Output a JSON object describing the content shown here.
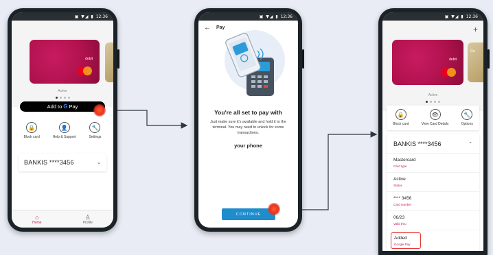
{
  "status_bar": {
    "time": "12:36",
    "icons": "▣ ▼◢ ▮"
  },
  "phone1": {
    "plus": "+",
    "card": {
      "type": "debit",
      "state": "Active"
    },
    "gpay_button": {
      "prefix": "Add to",
      "brand_g": "G",
      "brand_pay": "Pay"
    },
    "actions": [
      {
        "label": "Block card",
        "icon": "lock-icon",
        "glyph": "🔒"
      },
      {
        "label": "Help & Support",
        "icon": "person-icon",
        "glyph": "👤"
      },
      {
        "label": "Settings",
        "icon": "wrench-icon",
        "glyph": "🔧"
      }
    ],
    "account": {
      "name": "BANKIS ****3456",
      "chevron": "⌄"
    },
    "nav": [
      {
        "label": "Home",
        "icon": "home-icon",
        "glyph": "⌂",
        "active": true
      },
      {
        "label": "Profile",
        "icon": "profile-icon",
        "glyph": "♙",
        "active": false
      }
    ]
  },
  "phone2": {
    "back": "←",
    "title": "Pay",
    "heading_line1": "You're all set to pay with",
    "heading_line2": "your phone",
    "body": "Just make sure it's available and hold it to the terminal. You may need to unlock for some transactions.",
    "continue_label": "CONTINUE"
  },
  "phone3": {
    "plus": "+",
    "card": {
      "type": "debit",
      "state": "Active",
      "peek": "Go"
    },
    "actions": [
      {
        "label": "Block card",
        "icon": "lock-icon",
        "glyph": "🔒"
      },
      {
        "label": "View Card Details",
        "icon": "eye-icon",
        "glyph": "👁"
      },
      {
        "label": "Options",
        "icon": "wrench-icon",
        "glyph": "🔧"
      }
    ],
    "account": {
      "name": "BANKIS ****3456",
      "chevron": "⌃"
    },
    "details": [
      {
        "value": "Mastercard",
        "key": "Card type"
      },
      {
        "value": "Active",
        "key": "Status"
      },
      {
        "value": "**** 3456",
        "key": "Card number"
      },
      {
        "value": "06/23",
        "key": "Valid thru"
      }
    ],
    "added": {
      "value": "Added",
      "key": "Google Pay"
    }
  },
  "colors": {
    "accent": "#c2185b",
    "card": "#b0124d",
    "button": "#1f8ccb",
    "tap": "#e8321b"
  }
}
